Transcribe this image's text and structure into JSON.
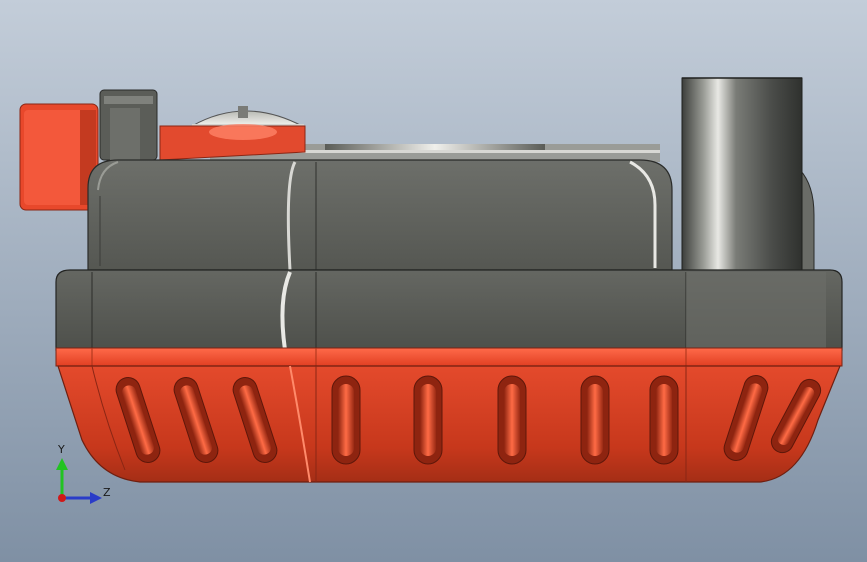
{
  "view": {
    "background_top": "#c2ccd8",
    "background_bottom": "#7f90a4"
  },
  "model": {
    "accent_color": "#e8452a",
    "body_color": "#5f615c",
    "slot_count_front": 5,
    "slot_count_left": 3,
    "slot_count_right": 2
  },
  "triad": {
    "y_label": "Y",
    "z_label": "Z",
    "y_color": "#22c322",
    "z_color": "#2a3cc8",
    "x_color": "#d01818"
  }
}
